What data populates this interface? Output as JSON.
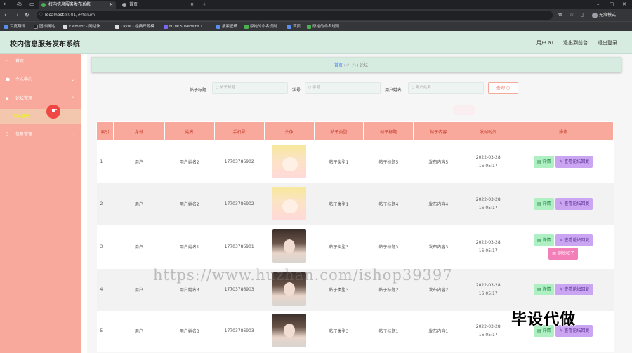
{
  "browser": {
    "tabs": [
      {
        "title": "校内信息服务发布系统"
      },
      {
        "title": "首页"
      }
    ],
    "new_tab": "+",
    "url_host": "localhost",
    "url_rest": ":8081/#/forum",
    "profile_label": "无痕模式"
  },
  "bookmarks": [
    {
      "label": "百度翻译"
    },
    {
      "label": "图标网站"
    },
    {
      "label": "Element - 网站快..."
    },
    {
      "label": "Layui - 经典开源模..."
    },
    {
      "label": "HTML5 Website T..."
    },
    {
      "label": "搜索壁纸"
    },
    {
      "label": "原始的命名规则"
    },
    {
      "label": "首页"
    },
    {
      "label": "原始的命名规则"
    }
  ],
  "header": {
    "title": "校内信息服务发布系统",
    "user": "用户 a1",
    "back_to_front": "退出到前台",
    "logout": "退出登录"
  },
  "sidebar": {
    "items": [
      {
        "label": "首页",
        "icon": "home-icon"
      },
      {
        "label": "个人中心",
        "icon": "user-icon"
      },
      {
        "label": "论坛管理",
        "icon": "forum-icon"
      },
      {
        "label": "信息管理",
        "icon": "info-icon"
      }
    ],
    "submenu": {
      "label": "论坛管理"
    }
  },
  "breadcrumb": {
    "home": "首页",
    "emoticon": "(•'◡'•)",
    "current": "论坛"
  },
  "search": {
    "title_label": "帖子标题",
    "title_placeholder": "帖子标题",
    "studentno_label": "学号",
    "studentno_placeholder": "学号",
    "username_label": "用户姓名",
    "username_placeholder": "用户姓名",
    "query_button": "查询"
  },
  "table": {
    "columns": [
      "索引",
      "身份",
      "姓名",
      "手机号",
      "头像",
      "帖子类型",
      "帖子标题",
      "帖子内容",
      "发帖时间",
      "操作"
    ],
    "rows": [
      {
        "index": "1",
        "identity": "用户",
        "name": "用户姓名2",
        "phone": "17703786902",
        "avatar": "anime",
        "type": "帖子类型1",
        "title": "帖子标题5",
        "content": "发布内容5",
        "time": "2022-03-28 16:05:17",
        "delete": false
      },
      {
        "index": "2",
        "identity": "用户",
        "name": "用户姓名2",
        "phone": "17703786902",
        "avatar": "anime",
        "type": "帖子类型1",
        "title": "帖子标题4",
        "content": "发布内容4",
        "time": "2022-03-28 16:05:17",
        "delete": false
      },
      {
        "index": "3",
        "identity": "用户",
        "name": "用户姓名1",
        "phone": "17703786901",
        "avatar": "real",
        "type": "帖子类型3",
        "title": "帖子标题3",
        "content": "发布内容3",
        "time": "2022-03-28 16:05:17",
        "delete": true
      },
      {
        "index": "4",
        "identity": "用户",
        "name": "用户姓名3",
        "phone": "17703786903",
        "avatar": "real",
        "type": "帖子类型3",
        "title": "帖子标题2",
        "content": "发布内容2",
        "time": "2022-03-28 16:05:17",
        "delete": false
      },
      {
        "index": "5",
        "identity": "用户",
        "name": "用户姓名3",
        "phone": "17703786903",
        "avatar": "real",
        "type": "帖子类型3",
        "title": "帖子标题1",
        "content": "发布内容1",
        "time": "2022-03-28 16:05:17",
        "delete": false
      }
    ],
    "actions": {
      "detail": "详情",
      "view_replies": "查看论坛回复",
      "delete": "删除帖子"
    }
  },
  "watermark": "https://www.huzhan.com/ishop39397",
  "overlay": "毕设代做"
}
